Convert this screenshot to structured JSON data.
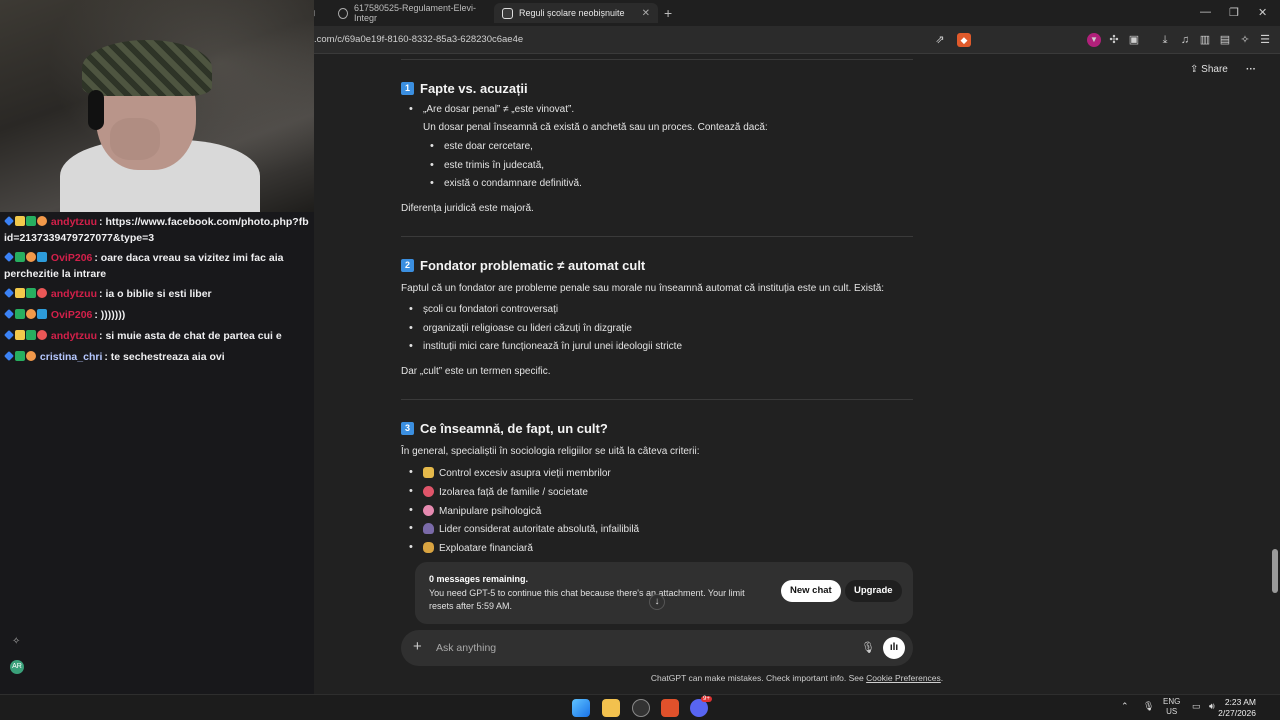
{
  "browser": {
    "tabs": [
      {
        "label": "617580525-Regulament-Elevi-Integr",
        "active": false
      },
      {
        "label": "Reguli școlare neobișnuite",
        "active": true
      }
    ],
    "url": ".com/c/69a0e19f-8160-8332-85a3-628230c6ae4e"
  },
  "chat_overlay": {
    "messages": [
      {
        "user": "andytzuu",
        "user_color": "#d2204a",
        "text": "https://www.facebook.com/photo.php?fbid=2137339479727077&type=3"
      },
      {
        "user": "OviP206",
        "user_color": "#d2204a",
        "text": "oare daca vreau sa vizitez imi fac aia perchezitie la intrare"
      },
      {
        "user": "andytzuu",
        "user_color": "#d2204a",
        "text": "ia o biblie si esti liber"
      },
      {
        "user": "OviP206",
        "user_color": "#d2204a",
        "text": ")))))))"
      },
      {
        "user": "andytzuu",
        "user_color": "#d2204a",
        "text": "si muie asta de chat de partea cui e"
      },
      {
        "user": "cristina_chri",
        "user_color": "#b6c8ff",
        "text": "te sechestreaza aia ovi"
      }
    ]
  },
  "header": {
    "share_label": "Share",
    "more_label": "···"
  },
  "article": {
    "s1": {
      "num": "1",
      "title": "Fapte vs. acuzații",
      "bullet": "„Are dosar penal” ≠ „este vinovat”.",
      "para": "Un dosar penal înseamnă că există o anchetă sau un proces. Contează dacă:",
      "sub": [
        "este doar cercetare,",
        "este trimis în judecată,",
        "există o condamnare definitivă."
      ],
      "conclusion": "Diferența juridică este majoră."
    },
    "s2": {
      "num": "2",
      "title": "Fondator problematic ≠ automat cult",
      "intro": "Faptul că un fondator are probleme penale sau morale nu înseamnă automat că instituția este un cult. Există:",
      "items": [
        "școli cu fondatori controversați",
        "organizații religioase cu lideri căzuți în dizgrație",
        "instituții mici care funcționează în jurul unei ideologii stricte"
      ],
      "conclusion": "Dar „cult” este un termen specific."
    },
    "s3": {
      "num": "3",
      "title": "Ce înseamnă, de fapt, un cult?",
      "intro": "În general, specialiștii în sociologia religiilor se uită la câteva criterii:",
      "items": [
        {
          "icon": "lock-icon",
          "color": "#e5b94a",
          "text": "Control excesiv asupra vieții membrilor"
        },
        {
          "icon": "no-entry-icon",
          "color": "#e0556a",
          "text": "Izolarea față de familie / societate"
        },
        {
          "icon": "brain-icon",
          "color": "#e68ab0",
          "text": "Manipulare psihologică"
        },
        {
          "icon": "person-icon",
          "color": "#7a6aa8",
          "text": "Lider considerat autoritate absolută, infailibilă"
        },
        {
          "icon": "money-bag-icon",
          "color": "#d9a441",
          "text": "Exploatare financiară"
        }
      ]
    }
  },
  "limit_banner": {
    "title": "0 messages remaining.",
    "text": "You need GPT-5 to continue this chat because there's an attachment. Your limit resets after 5:59 AM.",
    "new_chat": "New chat",
    "upgrade": "Upgrade"
  },
  "composer": {
    "placeholder": "Ask anything"
  },
  "footer": {
    "text": "ChatGPT can make mistakes. Check important info. See ",
    "link": "Cookie Preferences",
    "end": "."
  },
  "taskbar": {
    "lang1": "ENG",
    "lang2": "US",
    "time": "2:23 AM",
    "date": "2/27/2026",
    "badge": "9+"
  }
}
